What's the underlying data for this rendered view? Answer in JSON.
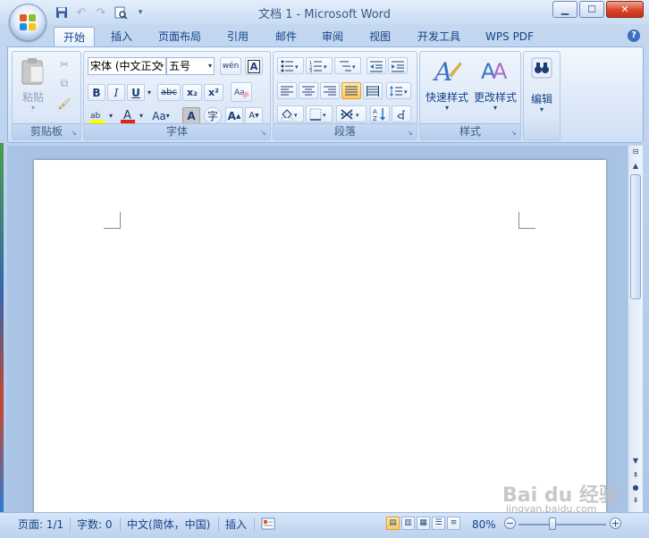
{
  "app": {
    "title": "文档 1 - Microsoft Word"
  },
  "qat": {
    "save_icon": "save-icon",
    "undo_icon": "undo-icon",
    "redo_icon": "redo-icon",
    "print_preview_icon": "print-preview-icon",
    "customize_icon": "chevron-down-icon"
  },
  "tabs": [
    {
      "label": "开始",
      "active": true
    },
    {
      "label": "插入"
    },
    {
      "label": "页面布局"
    },
    {
      "label": "引用"
    },
    {
      "label": "邮件"
    },
    {
      "label": "审阅"
    },
    {
      "label": "视图"
    },
    {
      "label": "开发工具"
    },
    {
      "label": "WPS PDF"
    }
  ],
  "ribbon": {
    "clipboard": {
      "label": "剪贴板",
      "paste": "粘贴"
    },
    "font": {
      "label": "字体",
      "font_name": "宋体 (中文正文",
      "font_size": "五号",
      "bold": "B",
      "italic": "I",
      "underline": "U",
      "strike": "abc",
      "subscript": "x₂",
      "superscript": "x²",
      "grow": "A",
      "shrink": "A",
      "change_case": "Aa",
      "char_shading": "A",
      "enclose": "字",
      "phonetic": "wén",
      "border": "A",
      "clear": "Aa"
    },
    "paragraph": {
      "label": "段落"
    },
    "styles": {
      "label": "样式",
      "quick": "快速样式",
      "change": "更改样式"
    },
    "editing": {
      "label": "编辑"
    }
  },
  "status": {
    "page": "页面: 1/1",
    "words": "字数: 0",
    "language": "中文(简体，中国)",
    "mode": "插入",
    "zoom": "80%"
  },
  "colors": {
    "accent": "#15428b",
    "highlight_active": "#ffc95a",
    "font_color": "#e0261b",
    "highlight_color": "#ffff00"
  },
  "watermark": {
    "brand": "Bai du 经验",
    "url": "jingyan.baidu.com"
  }
}
